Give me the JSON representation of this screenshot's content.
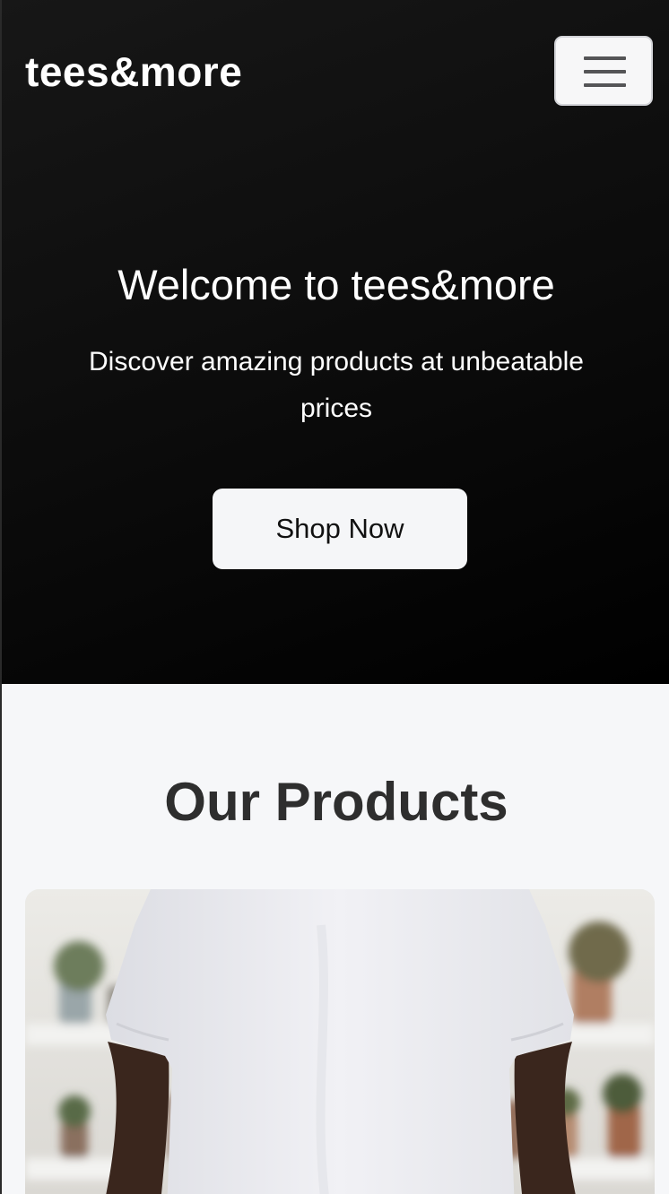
{
  "header": {
    "brand": "tees&more",
    "menu_icon": "hamburger-menu-icon"
  },
  "hero": {
    "title": "Welcome to tees&more",
    "subtitle": "Discover amazing products at unbeatable prices",
    "cta_label": "Shop Now"
  },
  "products": {
    "heading": "Our Products",
    "items": [
      {
        "image_alt": "white t-shirt"
      }
    ]
  },
  "colors": {
    "hero_bg": "#111111",
    "page_bg": "#f6f7f9",
    "button_bg": "#f5f6f8",
    "heading_text": "#2e2e2e"
  }
}
